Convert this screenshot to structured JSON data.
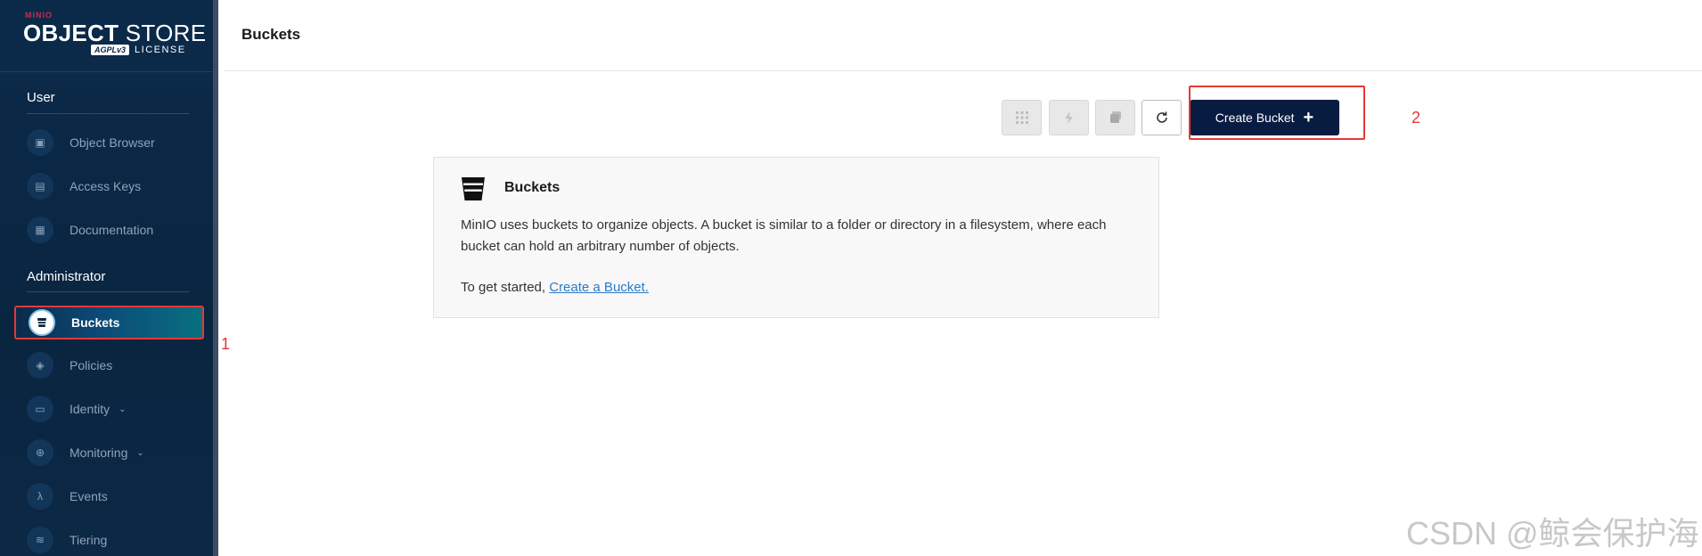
{
  "logo": {
    "brand_small": "MINIO",
    "product_bold": "OBJECT",
    "product_rest": " STORE",
    "badge": "AGPLv3",
    "license": "LICENSE"
  },
  "sidebar": {
    "section_user": "User",
    "section_admin": "Administrator",
    "user_items": [
      {
        "label": "Object Browser",
        "icon": "object-browser-icon"
      },
      {
        "label": "Access Keys",
        "icon": "access-keys-icon"
      },
      {
        "label": "Documentation",
        "icon": "documentation-icon"
      }
    ],
    "admin_items": [
      {
        "label": "Buckets",
        "icon": "bucket-icon",
        "active": true
      },
      {
        "label": "Policies",
        "icon": "policies-icon"
      },
      {
        "label": "Identity",
        "icon": "identity-icon",
        "expandable": true
      },
      {
        "label": "Monitoring",
        "icon": "monitoring-icon",
        "expandable": true
      },
      {
        "label": "Events",
        "icon": "lambda-icon"
      },
      {
        "label": "Tiering",
        "icon": "tiering-icon"
      }
    ]
  },
  "header": {
    "title": "Buckets"
  },
  "toolbar": {
    "create_label": "Create Bucket"
  },
  "info": {
    "title": "Buckets",
    "body": "MinIO uses buckets to organize objects. A bucket is similar to a folder or directory in a filesystem, where each bucket can hold an arbitrary number of objects.",
    "start_prefix": "To get started, ",
    "start_link": "Create a Bucket."
  },
  "annotations": {
    "one": "1",
    "two": "2"
  },
  "watermark": "CSDN @鲸会保护海",
  "colors": {
    "sidebar_bg": "#0a2540",
    "primary_button": "#081c42",
    "annotation_red": "#e53935",
    "link": "#2a7bc8"
  }
}
